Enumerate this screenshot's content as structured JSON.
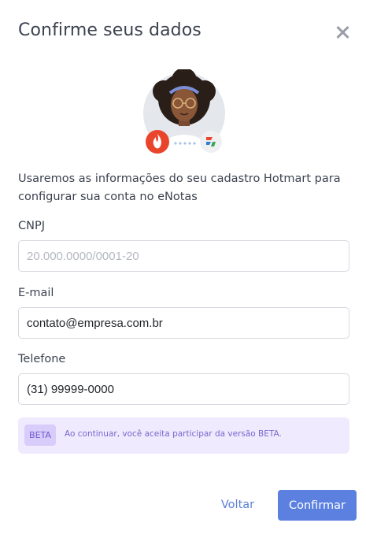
{
  "modal": {
    "title": "Confirme seus dados",
    "close_icon": "close-icon",
    "intro_text": "Usaremos as informações do seu cadastro Hotmart para configurar sua conta no eNotas"
  },
  "fields": {
    "cnpj": {
      "label": "CNPJ",
      "value": "",
      "placeholder": "20.000.0000/0001-20"
    },
    "email": {
      "label": "E-mail",
      "value": "contato@empresa.com.br",
      "placeholder": ""
    },
    "phone": {
      "label": "Telefone",
      "value": "(31) 99999-0000",
      "placeholder": ""
    }
  },
  "beta": {
    "badge": "BETA",
    "text": "Ao continuar, você aceita participar da versão BETA."
  },
  "actions": {
    "back_label": "Voltar",
    "confirm_label": "Confirmar"
  },
  "colors": {
    "primary": "#5b80e0",
    "link": "#5b7fd6",
    "beta_bg": "#efeafd",
    "beta_badge": "#d7ccfa",
    "beta_text": "#7a67cf",
    "hotmart_red": "#e9452b"
  }
}
